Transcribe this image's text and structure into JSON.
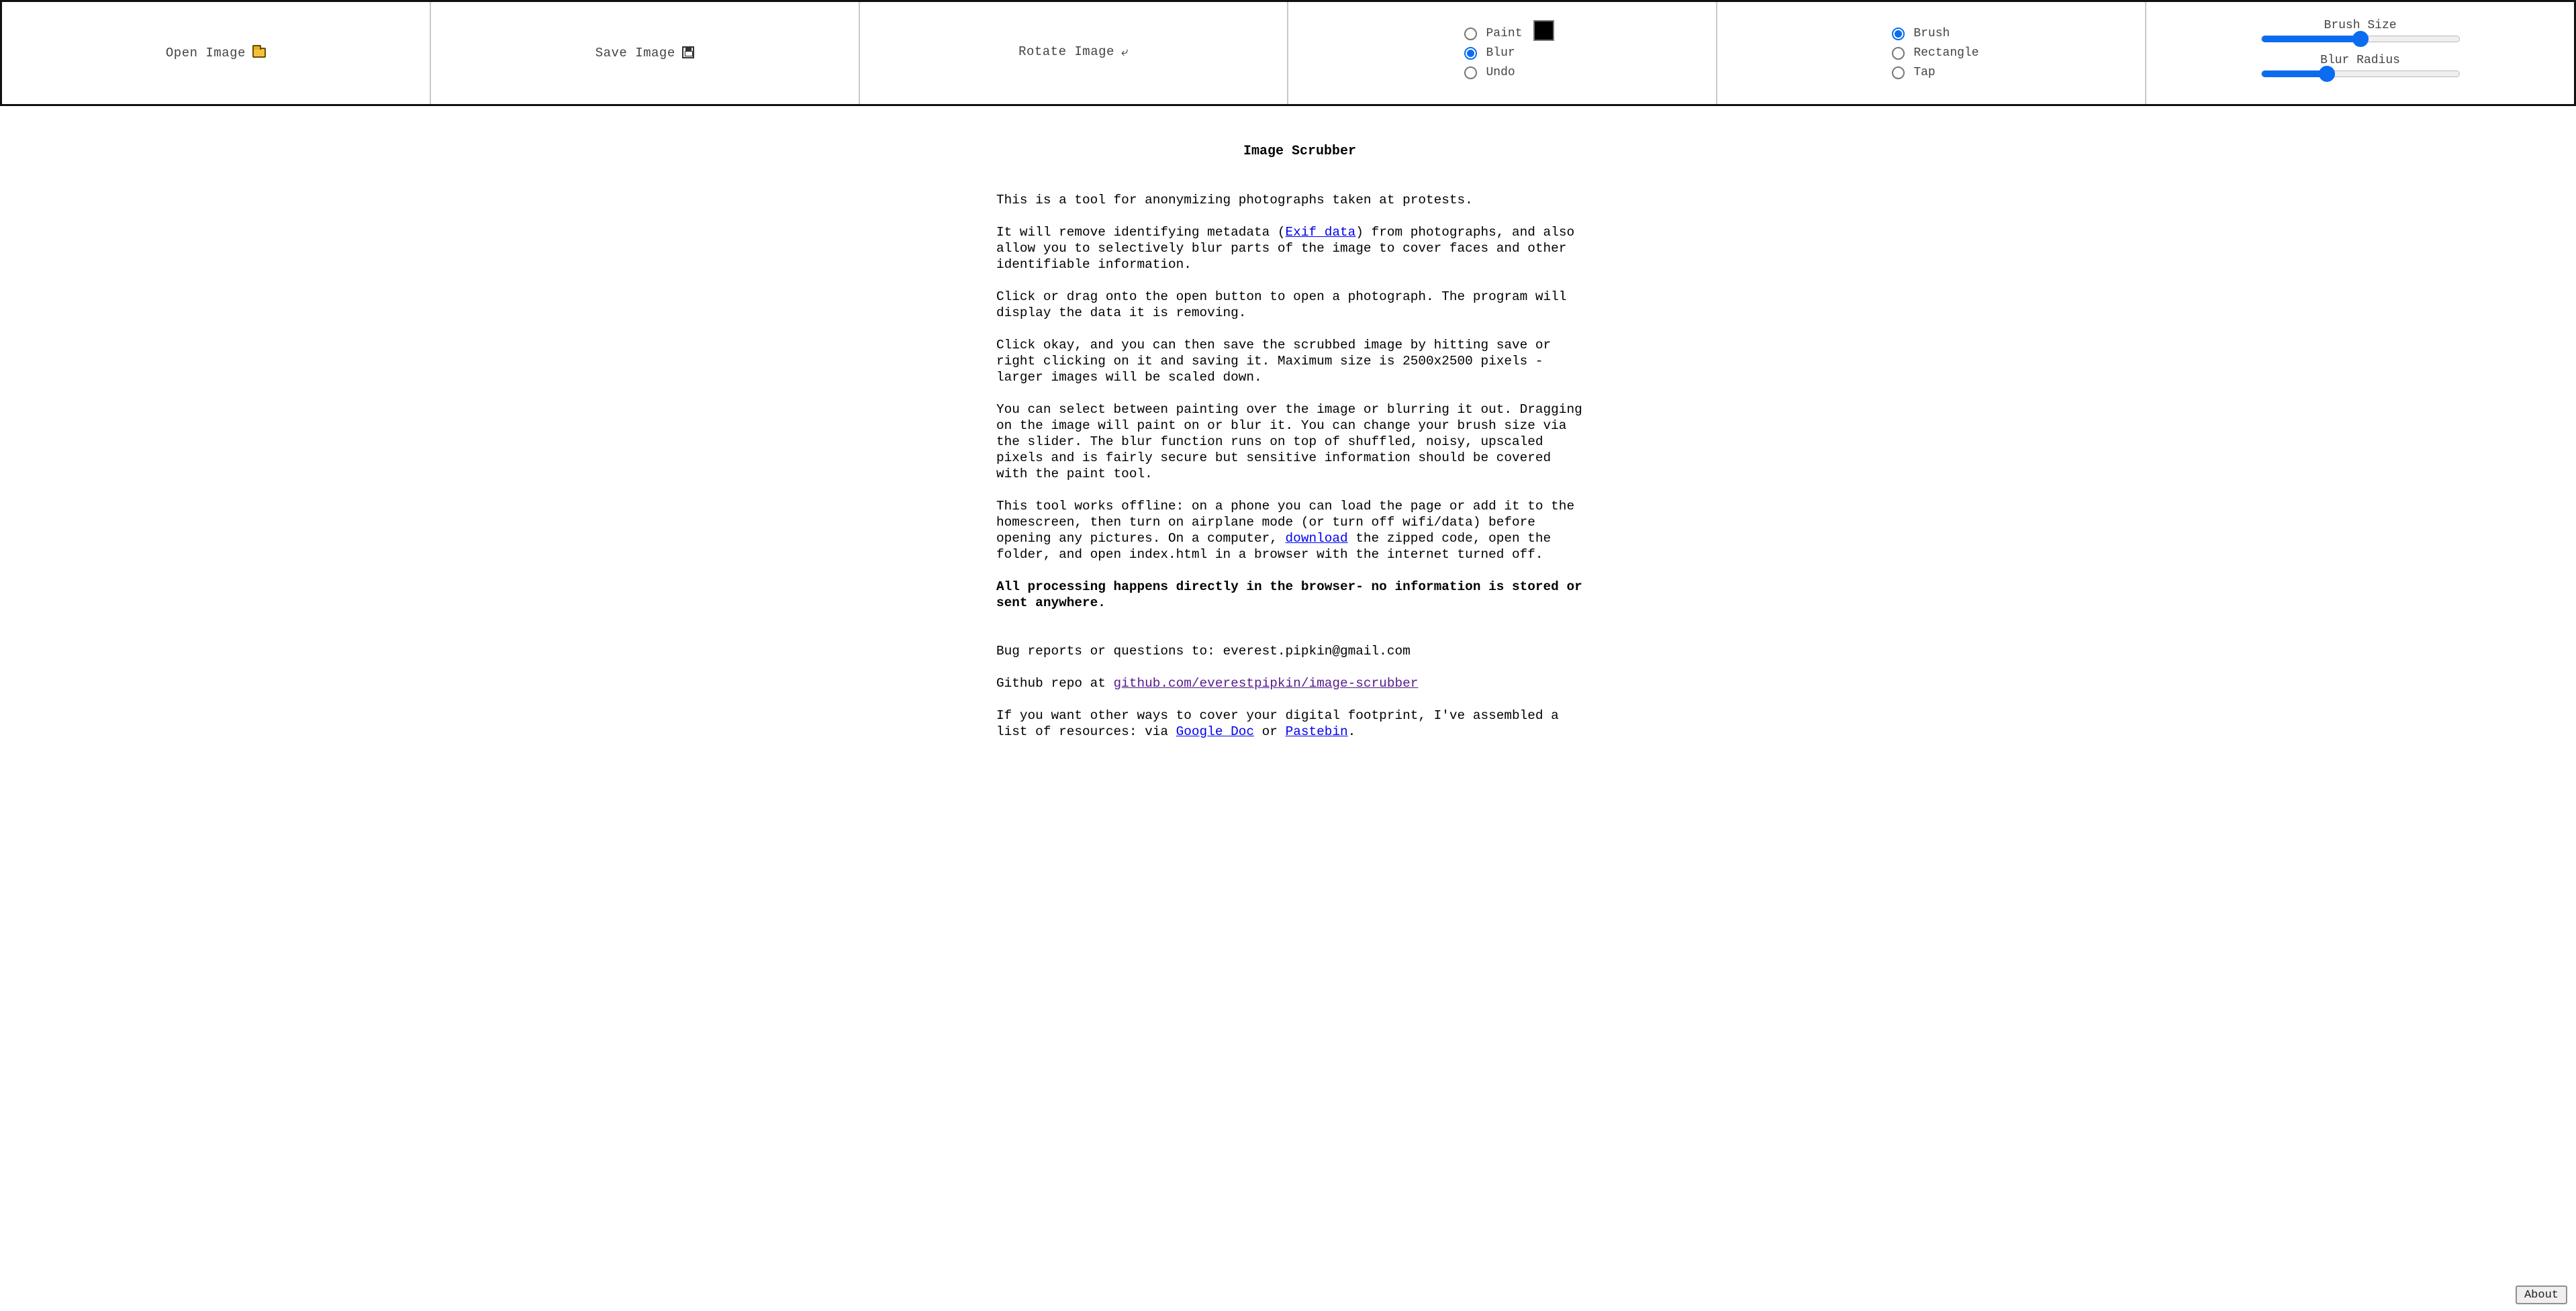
{
  "toolbar": {
    "open": {
      "label": "Open Image",
      "icon": "folder-icon"
    },
    "save": {
      "label": "Save Image",
      "icon": "floppy-disk-icon"
    },
    "rotate": {
      "label": "Rotate Image",
      "icon": "rotate-icon",
      "glyph": "⤶"
    },
    "mode": [
      {
        "label": "Paint",
        "checked": false
      },
      {
        "label": "Blur",
        "checked": true
      },
      {
        "label": "Undo",
        "checked": false
      }
    ],
    "paint_color": "#000000",
    "shape": [
      {
        "label": "Brush",
        "checked": true
      },
      {
        "label": "Rectangle",
        "checked": false
      },
      {
        "label": "Tap",
        "checked": false
      }
    ],
    "brush_size": {
      "label": "Brush Size",
      "value_fraction": 0.5
    },
    "blur_radius": {
      "label": "Blur Radius",
      "value_fraction": 0.33
    }
  },
  "main": {
    "title": "Image Scrubber",
    "p1": "This is a tool for anonymizing photographs taken at protests.",
    "p2_before": "It will remove identifying metadata (",
    "p2_link": "Exif data",
    "p2_after": ") from photographs, and also allow you to selectively blur parts of the image to cover faces and other identifiable information.",
    "p3": "Click or drag onto the open button to open a photograph. The program will display the data it is removing.",
    "p4": "Click okay, and you can then save the scrubbed image by hitting save or right clicking on it and saving it. Maximum size is 2500x2500 pixels - larger images will be scaled down.",
    "p5": "You can select between painting over the image or blurring it out. Dragging on the image will paint on or blur it. You can change your brush size via the slider. The blur function runs on top of shuffled, noisy, upscaled pixels and is fairly secure but sensitive information should be covered with the paint tool.",
    "p6_before": "This tool works offline: on a phone you can load the page or add it to the homescreen, then turn on airplane mode (or turn off wifi/data) before opening any pictures. On a computer, ",
    "p6_link": "download",
    "p6_after": " the zipped code, open the folder, and open index.html in a browser with the internet turned off.",
    "p7": "All processing happens directly in the browser- no information is stored or sent anywhere.",
    "p8": "Bug reports or questions to: everest.pipkin@gmail.com",
    "p9_before": "Github repo at ",
    "p9_link": "github.com/everestpipkin/image-scrubber",
    "p10_before": "If you want other ways to cover your digital footprint, I've assembled a list of resources: via ",
    "p10_link1": "Google Doc",
    "p10_mid": " or ",
    "p10_link2": "Pastebin",
    "p10_after": "."
  },
  "about": {
    "label": "About"
  }
}
